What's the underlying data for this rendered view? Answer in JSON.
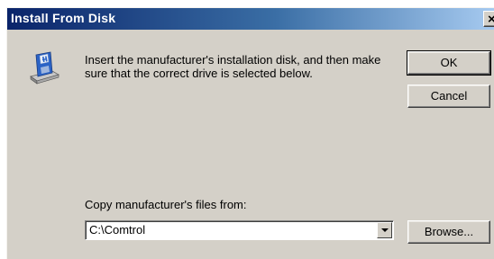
{
  "window": {
    "title": "Install From Disk",
    "close_glyph": "×"
  },
  "message": "Insert the manufacturer's installation disk, and then make sure that the correct drive is selected below.",
  "buttons": {
    "ok": "OK",
    "cancel": "Cancel",
    "browse": "Browse..."
  },
  "copy_from": {
    "label": "Copy manufacturer's files from:",
    "value": "C:\\Comtrol"
  },
  "icons": {
    "disk": "install-disk-icon",
    "close": "close-icon",
    "dropdown": "chevron-down-icon"
  },
  "colors": {
    "titlebar_start": "#0a246a",
    "titlebar_end": "#a6caf0",
    "dialog_face": "#d4d0c8"
  }
}
